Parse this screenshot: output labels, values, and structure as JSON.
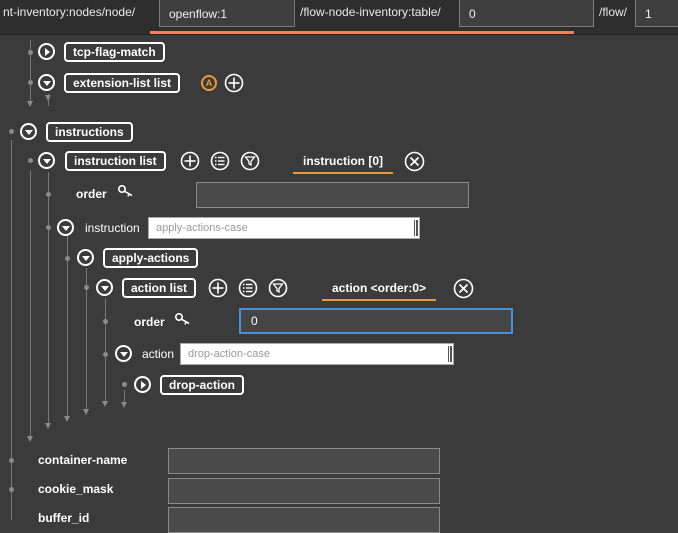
{
  "breadcrumb": {
    "segments": [
      {
        "text": "nt-inventory:nodes/node/",
        "input": "openflow:1"
      },
      {
        "text": "/flow-node-inventory:table/",
        "input": "0"
      },
      {
        "text": "/flow/",
        "input": "1"
      }
    ]
  },
  "tree": {
    "tcp_flag_match": "tcp-flag-match",
    "extension_list": "extension-list list",
    "extension_badge": "A",
    "instructions": "instructions",
    "instruction_list": "instruction list",
    "instruction_tab": "instruction [0]",
    "order_label": "order",
    "order_value": "",
    "instruction_label": "instruction",
    "instruction_select": "apply-actions-case",
    "apply_actions": "apply-actions",
    "action_list": "action list",
    "action_tab": "action  <order:0>",
    "action_order_label": "order",
    "action_order_value": "0",
    "action_label": "action",
    "action_select": "drop-action-case",
    "drop_action": "drop-action"
  },
  "fields": [
    {
      "label": "container-name",
      "value": ""
    },
    {
      "label": "cookie_mask",
      "value": ""
    },
    {
      "label": "buffer_id",
      "value": ""
    }
  ],
  "colors": {
    "accent_orange": "#e89b3c",
    "focus_blue": "#4a90d9",
    "strip": "#f08060"
  }
}
